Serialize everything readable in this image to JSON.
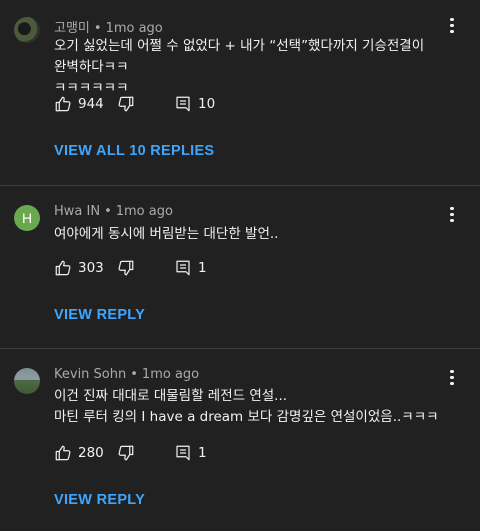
{
  "comments": [
    {
      "author": "고맹미",
      "time": "1mo ago",
      "avatar_icon": "dark-circle-avatar",
      "text_lines": [
        "오기 싫었는데 어쩔 수 없었다 + 내가 “선택”했다까지 기승전결이 완벽하다ㅋㅋ",
        "ㅋㅋㅋㅋㅋㅋ"
      ],
      "likes": "944",
      "replies_count": "10",
      "replies_label": "VIEW ALL 10 REPLIES"
    },
    {
      "author": "Hwa IN",
      "time": "1mo ago",
      "avatar_letter": "H",
      "text_lines": [
        "여야에게 동시에 버림받는 대단한 발언.."
      ],
      "likes": "303",
      "replies_count": "1",
      "replies_label": "VIEW REPLY"
    },
    {
      "author": "Kevin Sohn",
      "time": "1mo ago",
      "avatar_icon": "landscape-photo-avatar",
      "text_lines": [
        "이건 진짜 대대로 대물림할 레전드 연설...",
        "마틴 루터 킹의 I have a dream 보다 감명깊은 연설이었음..ㅋㅋㅋ"
      ],
      "likes": "280",
      "replies_count": "1",
      "replies_label": "VIEW REPLY"
    }
  ],
  "separator": "•",
  "colors": {
    "background": "#212121",
    "link": "#3ea6ff",
    "meta": "#aaaaaa"
  }
}
